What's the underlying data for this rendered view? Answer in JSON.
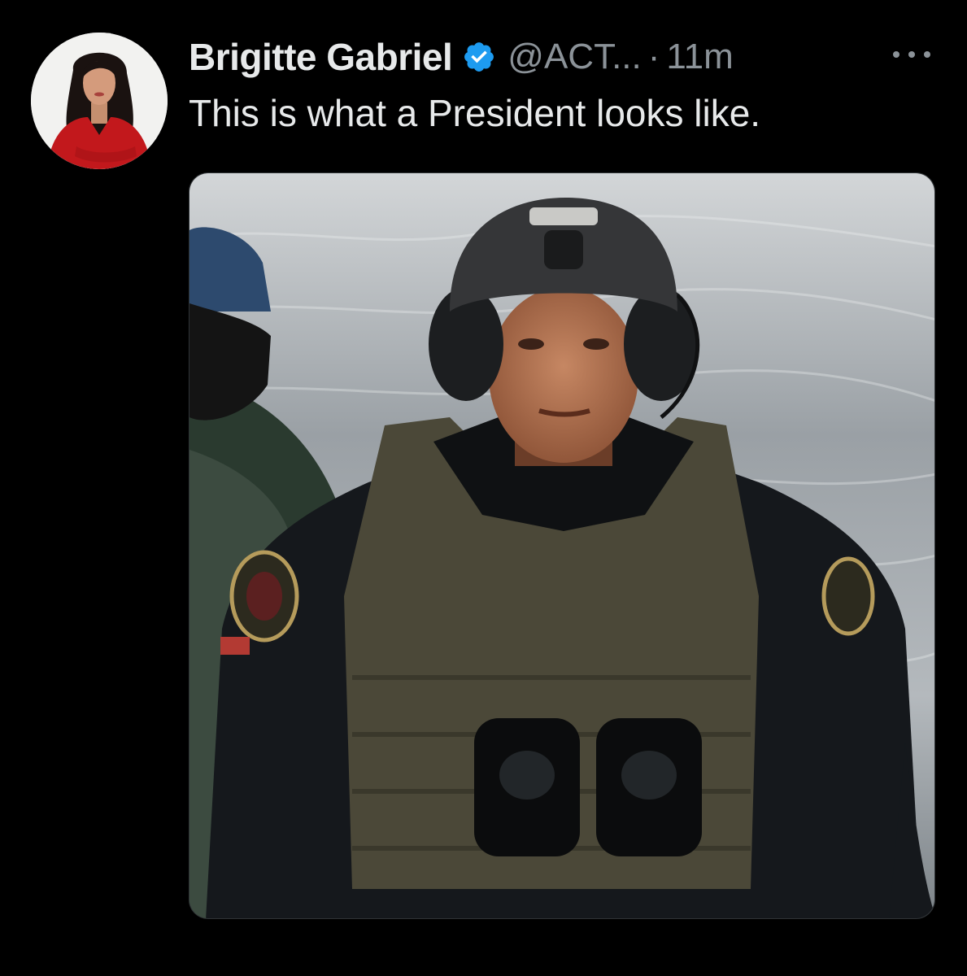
{
  "post": {
    "author": {
      "display_name": "Brigitte Gabriel",
      "handle": "@ACT...",
      "verified_icon": "verified-badge-icon"
    },
    "separator": "·",
    "timestamp": "11m",
    "more_icon": "more-options-icon",
    "text": "This is what a President looks like.",
    "media": {
      "type": "photo"
    }
  },
  "colors": {
    "background": "#000000",
    "primary_text": "#e7e9ea",
    "secondary_text": "#8b9298",
    "verified_blue": "#1d9bf0"
  }
}
